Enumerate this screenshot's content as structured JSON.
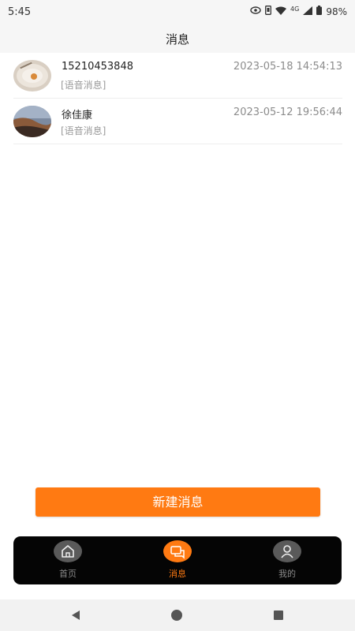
{
  "status_bar": {
    "time": "5:45",
    "network": "4G",
    "battery": "98%",
    "icons": [
      "eye-icon",
      "sim-icon",
      "wifi-icon",
      "signal-icon",
      "battery-icon"
    ]
  },
  "header": {
    "title": "消息"
  },
  "messages": [
    {
      "name": "15210453848",
      "preview": "[语音消息]",
      "time": "2023-05-18 14:54:13"
    },
    {
      "name": "徐佳康",
      "preview": "[语音消息]",
      "time": "2023-05-12 19:56:44"
    }
  ],
  "new_message_button": {
    "label": "新建消息"
  },
  "tab_bar": {
    "tabs": [
      {
        "label": "首页",
        "icon": "home-icon"
      },
      {
        "label": "消息",
        "icon": "chat-icon",
        "active": true
      },
      {
        "label": "我的",
        "icon": "user-icon"
      }
    ]
  },
  "colors": {
    "accent": "#ff7a12",
    "tab_bar_bg": "#050505",
    "header_bg": "#f6f6f6"
  },
  "system_nav": {
    "icons": [
      "back-icon",
      "home-circle-icon",
      "recents-icon"
    ]
  }
}
